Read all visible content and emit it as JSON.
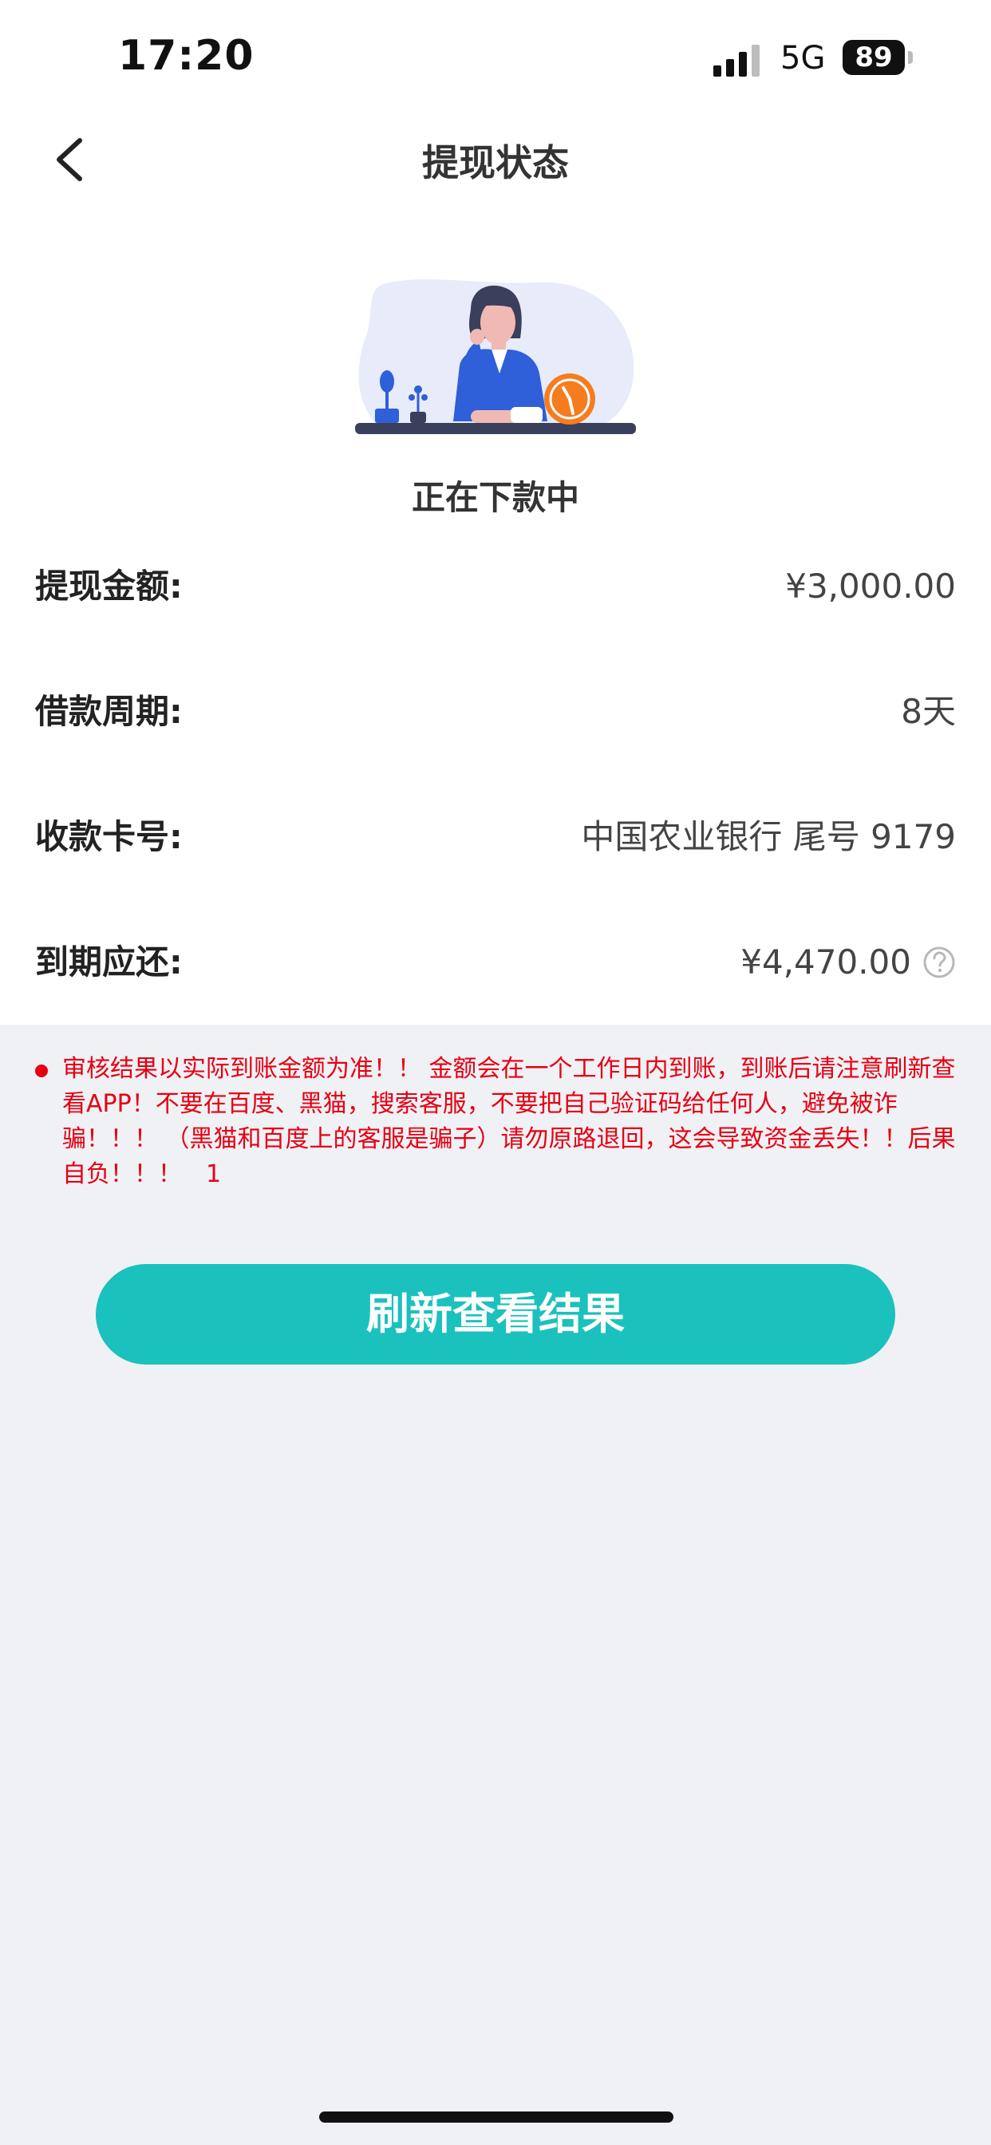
{
  "status_bar": {
    "time": "17:20",
    "network": "5G",
    "battery": "89"
  },
  "header": {
    "title": "提现状态"
  },
  "status": {
    "text": "正在下款中"
  },
  "details": [
    {
      "label": "提现金额:",
      "value": "¥3,000.00"
    },
    {
      "label": "借款周期:",
      "value": "8天"
    },
    {
      "label": "收款卡号:",
      "value": "中国农业银行 尾号 9179"
    },
    {
      "label": "到期应还:",
      "value": "¥4,470.00"
    }
  ],
  "notice": {
    "text": "审核结果以实际到账金额为准！！ 金额会在一个工作日内到账，到账后请注意刷新查看APP！不要在百度、黑猫，搜索客服，不要把自己验证码给任何人，避免被诈骗！！！ （黑猫和百度上的客服是骗子）请勿原路退回，这会导致资金丢失！！后果自负！！！　1"
  },
  "actions": {
    "refresh_label": "刷新查看结果"
  },
  "colors": {
    "accent": "#1bc1bd",
    "warning": "#e60012",
    "background": "#f0f1f5"
  }
}
